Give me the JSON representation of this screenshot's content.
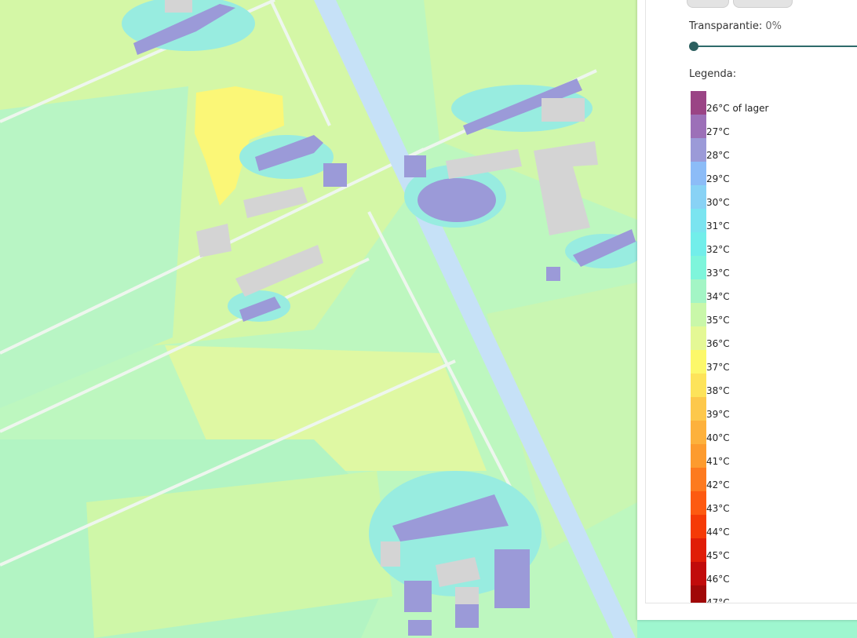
{
  "map": {
    "name": "heat-map",
    "colors": {
      "field_green": "#b8f7bf",
      "field_yellow": "#d8f79e",
      "hot_yellow": "#fbf777",
      "cool_purple": "#9b9ad8",
      "cyan": "#8fe8e2",
      "road_blue": "#c6e1f7",
      "building_gray": "#d4d4d4"
    }
  },
  "controls": {
    "transparency_label": "Transparantie:",
    "transparency_value": "0%",
    "transparency_level": 0,
    "legend_title": "Legenda:"
  },
  "legend": [
    {
      "label": "26°C of lager",
      "color": "#9a4485"
    },
    {
      "label": "27°C",
      "color": "#9c70b8"
    },
    {
      "label": "28°C",
      "color": "#9b9ad8"
    },
    {
      "label": "29°C",
      "color": "#8cbcf7"
    },
    {
      "label": "30°C",
      "color": "#88d2f5"
    },
    {
      "label": "31°C",
      "color": "#7ae4f0"
    },
    {
      "label": "32°C",
      "color": "#72eeea"
    },
    {
      "label": "33°C",
      "color": "#7ef5db"
    },
    {
      "label": "34°C",
      "color": "#a3f5c5"
    },
    {
      "label": "35°C",
      "color": "#c9f7a9"
    },
    {
      "label": "36°C",
      "color": "#e4f895"
    },
    {
      "label": "37°C",
      "color": "#fcf86a"
    },
    {
      "label": "38°C",
      "color": "#fde35a"
    },
    {
      "label": "39°C",
      "color": "#fdc84b"
    },
    {
      "label": "40°C",
      "color": "#fdb13c"
    },
    {
      "label": "41°C",
      "color": "#fd9b2e"
    },
    {
      "label": "42°C",
      "color": "#fd7a1f"
    },
    {
      "label": "43°C",
      "color": "#fd5a11"
    },
    {
      "label": "44°C",
      "color": "#f53a06"
    },
    {
      "label": "45°C",
      "color": "#e01d07"
    },
    {
      "label": "46°C",
      "color": "#c10b0b"
    },
    {
      "label": "47°C",
      "color": "#a00808"
    }
  ]
}
